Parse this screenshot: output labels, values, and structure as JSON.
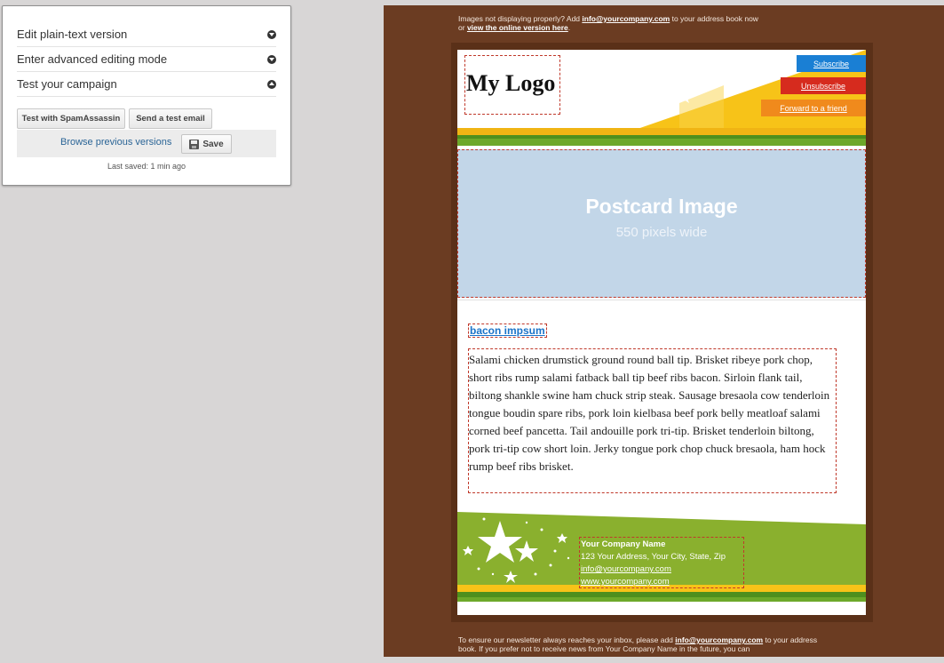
{
  "panel": {
    "rows": [
      {
        "label": "Edit plain-text version",
        "state": "collapsed"
      },
      {
        "label": "Enter advanced editing mode",
        "state": "collapsed"
      },
      {
        "label": "Test your campaign",
        "state": "expanded"
      }
    ],
    "test_spam_label": "Test with SpamAssassin",
    "send_test_label": "Send a test email",
    "browse_label": "Browse previous versions",
    "save_label": "Save",
    "last_saved": "Last saved: 1 min ago"
  },
  "email": {
    "pre_note_text": "Images not displaying properly? Add",
    "pre_note_email": "info@yourcompany.com",
    "pre_note_mid": "to your address book now",
    "pre_note_or": "or",
    "pre_note_link": "view the online version here",
    "logo": "My Logo",
    "links": {
      "subscribe": "Subscribe",
      "unsubscribe": "Unsubscribe",
      "forward": "Forward to a friend"
    },
    "postcard_title": "Postcard Image",
    "postcard_sub": "550 pixels wide",
    "heading": "bacon impsum",
    "body": "Salami chicken drumstick ground round ball tip. Brisket ribeye pork chop, short ribs rump salami fatback ball tip beef ribs bacon. Sirloin flank tail, biltong shankle swine ham chuck strip steak. Sausage bresaola cow tenderloin tongue boudin spare ribs, pork loin kielbasa beef pork belly meatloaf salami corned beef pancetta. Tail andouille pork tri-tip. Brisket tenderloin biltong, pork tri-tip cow short loin. Jerky tongue pork chop chuck bresaola, ham hock rump beef ribs brisket.",
    "company_name": "Your Company Name",
    "company_address": "123 Your Address, Your City, State, Zip",
    "company_email": "info@yourcompany.com",
    "company_site": "www.yourcompany.com",
    "post_note_a": "To ensure our newsletter always reaches your inbox, please add",
    "post_note_email": "info@yourcompany.com",
    "post_note_b": "to your address book. If you prefer not to receive news from Your Company Name in the future, you can"
  },
  "colors": {
    "preview_bg": "#6b3c22",
    "subscribe": "#1a7fd4",
    "unsubscribe": "#d62b1e",
    "forward": "#f08a1c",
    "footer_green": "#8ab02e",
    "header_yellow": "#f7c318"
  }
}
